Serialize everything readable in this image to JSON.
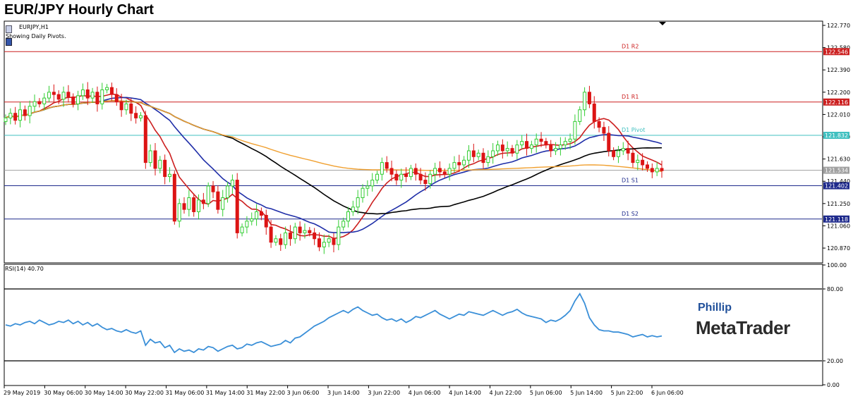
{
  "title": "EUR/JPY Hourly Chart",
  "symbol_label": "EURJPY,H1",
  "pivot_note": "Showing Daily Pivots.",
  "brand": {
    "line1": "Phillip",
    "line2": "MetaTrader"
  },
  "colors": {
    "bull": "#32cd32",
    "bear": "#dc1414",
    "ma_fast": "#cc1f1f",
    "ma_mid": "#1f2ea8",
    "ma_slow": "#000000",
    "ma_long": "#f0a030",
    "pivot": "#40c0c0",
    "resistance": "#cc2020",
    "support": "#1e2a8c",
    "rsi": "#3a8fd8"
  },
  "chart_data": [
    {
      "type": "candlestick",
      "title": "EUR/JPY Hourly Chart",
      "ylim": [
        120.75,
        122.8
      ],
      "y_ticks": [
        "122.770",
        "122.580",
        "122.390",
        "122.200",
        "122.010",
        "121.820",
        "121.630",
        "121.440",
        "121.250",
        "121.060",
        "120.870"
      ],
      "x_ticks": [
        "29 May 2019",
        "30 May 06:00",
        "30 May 14:00",
        "30 May 22:00",
        "31 May 06:00",
        "31 May 14:00",
        "31 May 22:00",
        "3 Jun 06:00",
        "3 Jun 14:00",
        "3 Jun 22:00",
        "4 Jun 06:00",
        "4 Jun 14:00",
        "4 Jun 22:00",
        "5 Jun 06:00",
        "5 Jun 14:00",
        "5 Jun 22:00",
        "6 Jun 06:00"
      ],
      "levels": [
        {
          "name": "D1 R2",
          "value": 122.546,
          "label": "122.546",
          "kind": "resistance"
        },
        {
          "name": "D1 R1",
          "value": 122.116,
          "label": "122.116",
          "kind": "resistance"
        },
        {
          "name": "D1 Pivot",
          "value": 121.832,
          "label": "121.832",
          "kind": "pivot"
        },
        {
          "name": "D1 S1",
          "value": 121.402,
          "label": "121.402",
          "kind": "support"
        },
        {
          "name": "D1 S2",
          "value": 121.118,
          "label": "121.118",
          "kind": "support"
        }
      ],
      "current_price": {
        "value": 121.534,
        "label": "121.534"
      },
      "close_series": [
        121.98,
        122.02,
        121.96,
        122.05,
        122.0,
        122.08,
        122.12,
        122.1,
        122.15,
        122.2,
        122.18,
        122.14,
        122.2,
        122.16,
        122.1,
        122.17,
        122.22,
        122.15,
        122.2,
        122.1,
        122.22,
        122.24,
        122.18,
        122.12,
        122.05,
        122.1,
        122.02,
        121.98,
        122.0,
        121.6,
        121.7,
        121.55,
        121.62,
        121.48,
        121.5,
        121.1,
        121.25,
        121.2,
        121.3,
        121.18,
        121.28,
        121.25,
        121.4,
        121.35,
        121.2,
        121.3,
        121.4,
        121.45,
        121.0,
        121.05,
        121.1,
        121.12,
        121.18,
        121.15,
        121.05,
        120.92,
        120.95,
        120.9,
        121.0,
        120.95,
        121.05,
        121.0,
        121.02,
        121.0,
        120.95,
        120.88,
        120.92,
        120.95,
        120.9,
        121.05,
        121.1,
        121.18,
        121.22,
        121.3,
        121.38,
        121.4,
        121.45,
        121.5,
        121.6,
        121.55,
        121.5,
        121.45,
        121.5,
        121.48,
        121.55,
        121.5,
        121.45,
        121.42,
        121.5,
        121.55,
        121.52,
        121.5,
        121.55,
        121.6,
        121.58,
        121.62,
        121.7,
        121.65,
        121.68,
        121.6,
        121.65,
        121.7,
        121.75,
        121.7,
        121.72,
        121.68,
        121.75,
        121.78,
        121.72,
        121.75,
        121.8,
        121.78,
        121.75,
        121.7,
        121.72,
        121.75,
        121.78,
        121.8,
        121.95,
        122.05,
        122.2,
        122.1,
        121.95,
        121.9,
        121.85,
        121.7,
        121.65,
        121.7,
        121.72,
        121.68,
        121.6,
        121.62,
        121.58,
        121.55,
        121.52,
        121.55,
        121.53
      ],
      "series": [
        {
          "name": "MA fast",
          "role": "ma_fast"
        },
        {
          "name": "MA mid",
          "role": "ma_mid"
        },
        {
          "name": "MA slow",
          "role": "ma_slow"
        },
        {
          "name": "MA long",
          "role": "ma_long"
        }
      ]
    },
    {
      "type": "line",
      "label": "RSI(14) 40.70",
      "ylim": [
        0,
        100
      ],
      "y_ticks": [
        "100.00",
        "80.00",
        "20.00",
        "0.00"
      ],
      "levels": [
        80,
        20
      ],
      "values": [
        50,
        49,
        51,
        50,
        52,
        53,
        51,
        54,
        52,
        50,
        51,
        53,
        52,
        54,
        51,
        53,
        50,
        52,
        49,
        51,
        48,
        46,
        47,
        45,
        44,
        46,
        44,
        43,
        45,
        33,
        38,
        35,
        36,
        31,
        33,
        27,
        30,
        28,
        29,
        27,
        30,
        29,
        32,
        31,
        28,
        30,
        32,
        33,
        30,
        31,
        34,
        33,
        35,
        36,
        34,
        32,
        33,
        34,
        37,
        35,
        39,
        40,
        43,
        46,
        49,
        51,
        53,
        56,
        58,
        60,
        62,
        60,
        63,
        65,
        62,
        60,
        58,
        59,
        56,
        54,
        55,
        53,
        55,
        52,
        54,
        57,
        56,
        58,
        60,
        62,
        59,
        57,
        55,
        57,
        59,
        58,
        61,
        60,
        59,
        58,
        60,
        62,
        60,
        58,
        60,
        61,
        63,
        60,
        58,
        57,
        56,
        55,
        52,
        54,
        53,
        55,
        58,
        62,
        70,
        76,
        68,
        56,
        50,
        46,
        45,
        45,
        44,
        44,
        43,
        42,
        40,
        41,
        42,
        40,
        41,
        40,
        40.7
      ]
    }
  ]
}
